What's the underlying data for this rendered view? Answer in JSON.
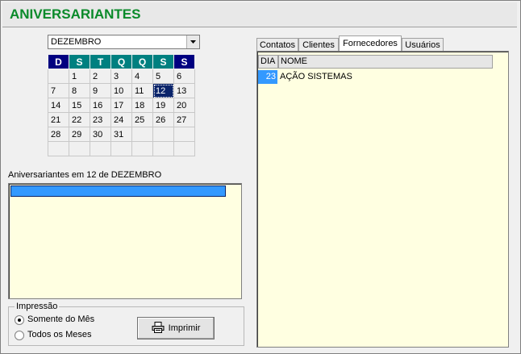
{
  "window": {
    "title": "ANIVERSARIANTES"
  },
  "calendar": {
    "month": "DEZEMBRO",
    "weekdays": [
      "D",
      "S",
      "T",
      "Q",
      "Q",
      "S",
      "S"
    ],
    "weeks": [
      [
        "",
        "1",
        "2",
        "3",
        "4",
        "5",
        "6"
      ],
      [
        "7",
        "8",
        "9",
        "10",
        "11",
        "12",
        "13"
      ],
      [
        "14",
        "15",
        "16",
        "17",
        "18",
        "19",
        "20"
      ],
      [
        "21",
        "22",
        "23",
        "24",
        "25",
        "26",
        "27"
      ],
      [
        "28",
        "29",
        "30",
        "31",
        "",
        "",
        ""
      ],
      [
        "",
        "",
        "",
        "",
        "",
        "",
        ""
      ]
    ],
    "selected_day": "12"
  },
  "birthdays": {
    "label": "Aniversariantes em 12 de DEZEMBRO",
    "items": [
      ""
    ]
  },
  "print": {
    "group_label": "Impressão",
    "option_month": "Somente do Mês",
    "option_all": "Todos os Meses",
    "selected": "month",
    "button_label": "Imprimir"
  },
  "tabs": {
    "items": [
      "Contatos",
      "Clientes",
      "Fornecedores",
      "Usuários"
    ],
    "active": "Fornecedores"
  },
  "grid": {
    "columns": [
      "DIA",
      "NOME"
    ],
    "rows": [
      {
        "dia": "23",
        "nome": "AÇÃO SISTEMAS"
      }
    ]
  },
  "colors": {
    "title": "#0a8a2a",
    "weekday_dark": "#000080",
    "weekday_teal": "#008080",
    "list_bg": "#ffffe1",
    "selection": "#3399ff"
  }
}
